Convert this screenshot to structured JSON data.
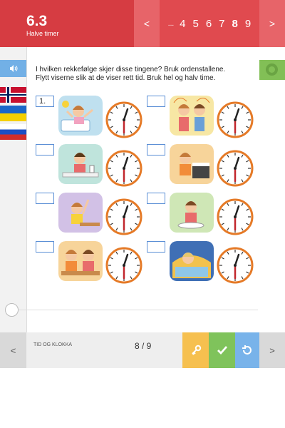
{
  "header": {
    "chapter_number": "6.3",
    "chapter_title": "Halve timer",
    "prev": "<",
    "ellipsis": "...",
    "pages": [
      "4",
      "5",
      "6",
      "7",
      "8",
      "9"
    ],
    "current_page": "8",
    "next": ">"
  },
  "sidebar": {
    "audio_icon": "speaker-icon",
    "flags": [
      "norway",
      "ukraine",
      "russia"
    ]
  },
  "instructions": {
    "line1": "I hvilken rekkefølge skjer disse tingene? Bruk ordenstallene.",
    "line2": "Flytt viserne slik at de viser rett tid. Bruk hel og halv time."
  },
  "items": [
    {
      "answer": "1.",
      "scene": "child waking up in bed"
    },
    {
      "answer": "",
      "scene": "two children brushing hair"
    },
    {
      "answer": "",
      "scene": "child eating at table"
    },
    {
      "answer": "",
      "scene": "child playing piano"
    },
    {
      "answer": "",
      "scene": "child raising hand at school desk"
    },
    {
      "answer": "",
      "scene": "child eating dinner"
    },
    {
      "answer": "",
      "scene": "two children sitting at table"
    },
    {
      "answer": "",
      "scene": "child sleeping in bed"
    }
  ],
  "clock": {
    "hour": 12,
    "minute": 30
  },
  "footer": {
    "prev": "<",
    "label": "TID OG KLOKKA",
    "page_indicator": "8 / 9",
    "next": ">"
  },
  "colors": {
    "header_red": "#e04a4f",
    "key_yellow": "#f6c04f",
    "check_green": "#7fc35b",
    "reset_blue": "#78b3ea",
    "award_green": "#82bf56"
  }
}
